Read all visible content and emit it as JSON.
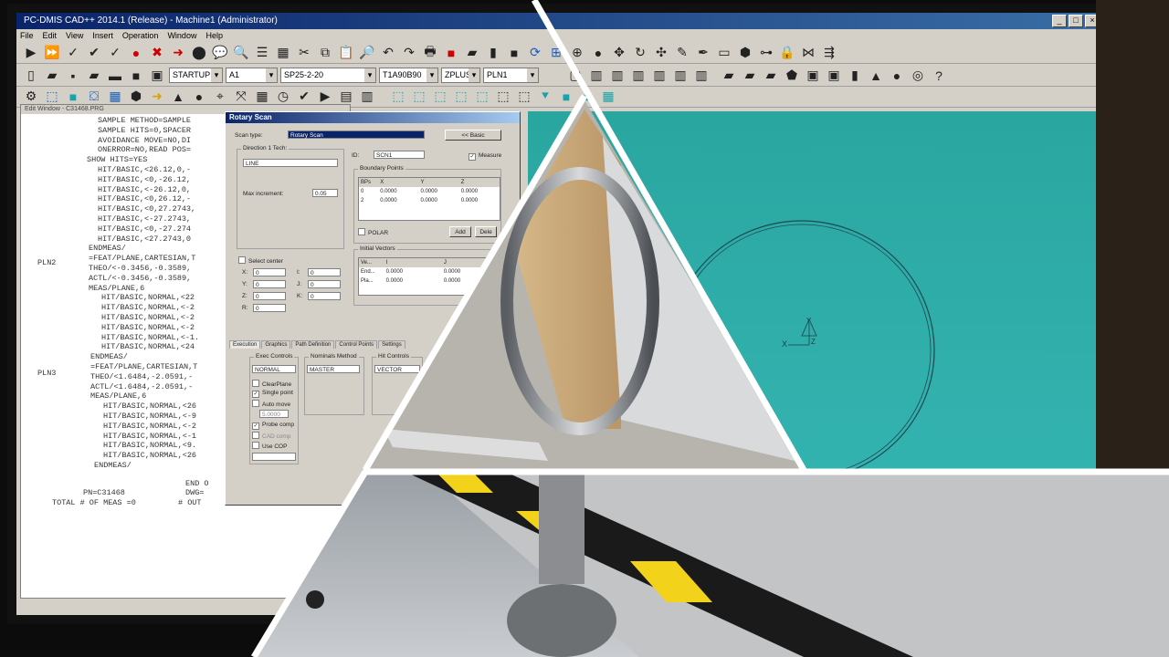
{
  "window": {
    "title": "PC-DMIS CAD++ 2014.1 (Release) - Machine1 (Administrator)"
  },
  "menu": [
    "File",
    "Edit",
    "View",
    "Insert",
    "Operation",
    "Window",
    "Help"
  ],
  "toolbar2": {
    "startup": "STARTUP",
    "tip": "A1",
    "probe": "SP25-2-20",
    "angle": "T1A90B90",
    "workplane": "ZPLUS",
    "plane": "PLN1"
  },
  "editor": {
    "header": "Edit Window - C31468.PRG",
    "lines": [
      "SAMPLE METHOD=SAMPLE",
      "SAMPLE HITS=0,SPACER",
      "AVOIDANCE MOVE=NO,DI",
      "ONERROR=NO,READ POS=",
      "SHOW HITS=YES",
      "HIT/BASIC,<26.12,0,-",
      "HIT/BASIC,<0,-26.12,",
      "HIT/BASIC,<-26.12,0,",
      "HIT/BASIC,<0,26.12,-",
      "HIT/BASIC,<0,27.2743,",
      "HIT/BASIC,<-27.2743,",
      "HIT/BASIC,<0,-27.274",
      "HIT/BASIC,<27.2743,0",
      "ENDMEAS/",
      "=FEAT/PLANE,CARTESIAN,T",
      "THEO/<-0.3456,-0.3589,",
      "ACTL/<-0.3456,-0.3589,",
      "MEAS/PLANE,6",
      "HIT/BASIC,NORMAL,<22",
      "HIT/BASIC,NORMAL,<-2",
      "HIT/BASIC,NORMAL,<-2",
      "HIT/BASIC,NORMAL,<-2",
      "HIT/BASIC,NORMAL,<-1.",
      "HIT/BASIC,NORMAL,<24",
      "ENDMEAS/",
      "=FEAT/PLANE,CARTESIAN,T",
      "THEO/<1.6484,-2.0591,-",
      "ACTL/<1.6484,-2.0591,-",
      "MEAS/PLANE,6",
      "HIT/BASIC,NORMAL,<26",
      "HIT/BASIC,NORMAL,<-9",
      "HIT/BASIC,NORMAL,<-2",
      "HIT/BASIC,NORMAL,<-1",
      "HIT/BASIC,NORMAL,<9.",
      "HIT/BASIC,NORMAL,<26",
      "ENDMEAS/"
    ],
    "labels": [
      "PLN2",
      "PLN3"
    ],
    "footer_left": "PN=C31468",
    "footer_left2": "TOTAL # OF MEAS =0",
    "footer_right": "END O",
    "footer_right2": "DWG=",
    "footer_right3": "# OUT"
  },
  "dialog": {
    "title": "Rotary Scan",
    "scan_type_label": "Scan type:",
    "scan_type": "Rotary Scan",
    "basic_button": "<< Basic",
    "dir_group": "Direction 1 Tech:",
    "dir_value": "LINE",
    "id_label": "ID:",
    "id_value": "SCN1",
    "measure_label": "Measure",
    "max_inc_label": "Max increment:",
    "max_inc_value": "0.05",
    "boundary_group": "Boundary Points",
    "bp_headers": [
      "BPs",
      "X",
      "Y",
      "Z"
    ],
    "bp_rows": [
      [
        "0",
        "0.0000",
        "0.0000",
        "0.0000"
      ],
      [
        "2",
        "0.0000",
        "0.0000",
        "0.0000"
      ]
    ],
    "polar_label": "POLAR",
    "add_button": "Add",
    "delete_button": "Dele",
    "select_center_label": "Select center",
    "coord_labels": [
      "X:",
      "Y:",
      "Z:",
      "R:"
    ],
    "coord_labels2": [
      "I:",
      "J:",
      "K:"
    ],
    "coord_values": [
      "0",
      "0",
      "0",
      "0"
    ],
    "coord_values2": [
      "0",
      "0",
      "0"
    ],
    "init_vec_group": "Initial Vectors",
    "iv_headers": [
      "Ve...",
      "I",
      "J"
    ],
    "iv_rows": [
      [
        "End...",
        "0.0000",
        "0.0000"
      ],
      [
        "Pla...",
        "0.0000",
        "0.0000"
      ]
    ],
    "tabs": [
      "Execution",
      "Graphics",
      "Path Definition",
      "Control Points",
      "Settings"
    ],
    "exec_group": "Exec Controls",
    "exec_value": "NORMAL",
    "nominals_group": "Nominals Method",
    "nominals_value": "MASTER",
    "hit_group": "Hit Controls",
    "hit_value": "VECTOR",
    "checks": [
      "ClearPlane",
      "Single point",
      "Auto move",
      "Probe comp",
      "CAD comp",
      "Use COP"
    ],
    "auto_move_value": "5.0000"
  },
  "cad": {
    "axis_x": "X",
    "axis_y": "Y",
    "axis_z": "Z"
  }
}
